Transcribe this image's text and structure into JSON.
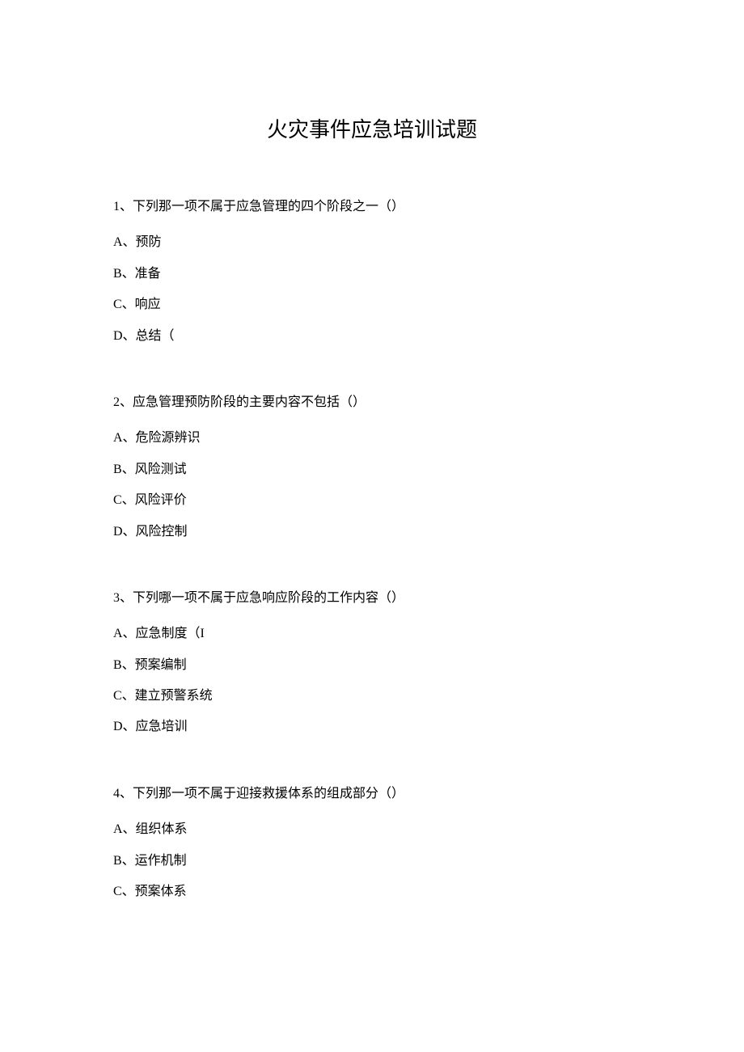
{
  "title": "火灾事件应急培训试题",
  "questions": [
    {
      "prompt": "1、下列那一项不属于应急管理的四个阶段之一（）",
      "options": [
        "A、预防",
        "B、准备",
        "C、响应",
        "D、总结（"
      ]
    },
    {
      "prompt": "2、应急管理预防阶段的主要内容不包括（）",
      "options": [
        "A、危险源辨识",
        "B、风险测试",
        "C、风险评价",
        "D、风险控制"
      ]
    },
    {
      "prompt": "3、下列哪一项不属于应急响应阶段的工作内容（）",
      "options": [
        "A、应急制度（I",
        "B、预案编制",
        "C、建立预警系统",
        "D、应急培训"
      ]
    },
    {
      "prompt": "4、下列那一项不属于迎接救援体系的组成部分（）",
      "options": [
        "A、组织体系",
        "B、运作机制",
        "C、预案体系"
      ]
    }
  ]
}
